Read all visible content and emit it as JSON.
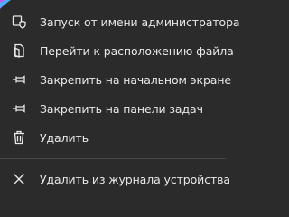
{
  "context_menu": {
    "items": [
      {
        "label": "Запуск от имени администратора",
        "icon": "shield-app-icon"
      },
      {
        "label": "Перейти к расположению файла",
        "icon": "document-open-icon"
      },
      {
        "label": "Закрепить на начальном экране",
        "icon": "pin-icon"
      },
      {
        "label": "Закрепить на панели задач",
        "icon": "pin-icon"
      },
      {
        "label": "Удалить",
        "icon": "trash-icon"
      }
    ],
    "remove_history": {
      "label": "Удалить из журнала устройства",
      "icon": "close-icon"
    }
  }
}
